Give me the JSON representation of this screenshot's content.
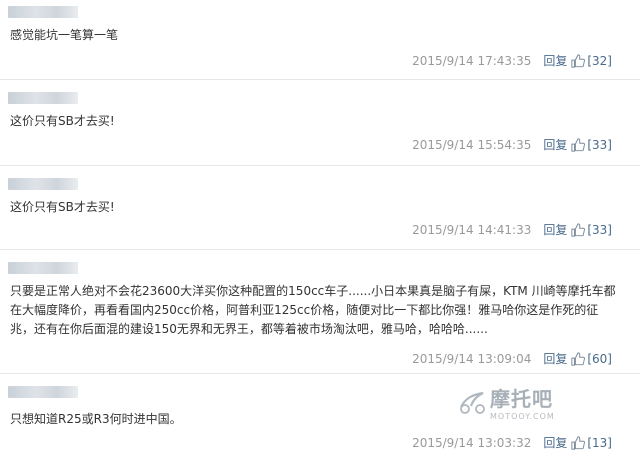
{
  "comments": [
    {
      "text": "感觉能坑一笔算一笔",
      "time": "2015/9/14 17:43:35",
      "reply": "回复",
      "likes": "[32]"
    },
    {
      "text": "这价只有SB才去买!",
      "time": "2015/9/14 15:54:35",
      "reply": "回复",
      "likes": "[33]"
    },
    {
      "text": "这价只有SB才去买!",
      "time": "2015/9/14 14:41:33",
      "reply": "回复",
      "likes": "[33]"
    },
    {
      "text": "只要是正常人绝对不会花23600大洋买你这种配置的150cc车子......小日本果真是脑子有屎，KTM 川崎等摩托车都在大幅度降价，再看看国内250cc价格，阿普利亚125cc价格，随便对比一下都比你强！雅马哈你这是作死的征兆，还有在你后面混的建设150无界和无界王，都等着被市场淘汰吧，雅马哈，哈哈哈......",
      "time": "2015/9/14 13:09:04",
      "reply": "回复",
      "likes": "[60]"
    },
    {
      "text": "只想知道R25或R3何时进中国。",
      "time": "2015/9/14 13:03:32",
      "reply": "回复",
      "likes": "[13]"
    }
  ],
  "watermark": {
    "name_cn": "摩托吧",
    "name_en": "MOTOOY.COM"
  },
  "colors": {
    "link": "#4a6a8c",
    "meta": "#999999",
    "divider": "#e6e6e6"
  }
}
